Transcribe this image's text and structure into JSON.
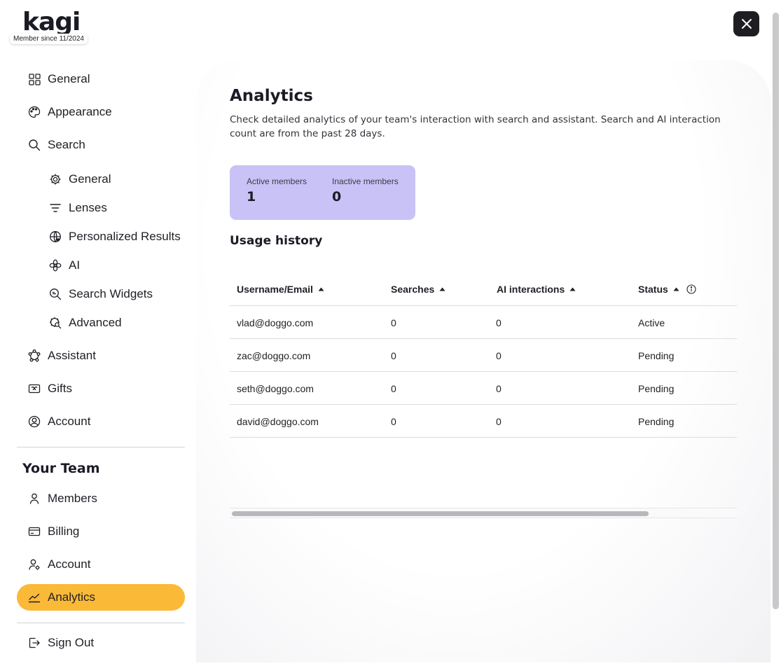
{
  "brand": {
    "logo_text": "kagi",
    "member_since": "Member since 11/2024"
  },
  "close_icon": "close-x-icon",
  "sidebar": {
    "items": [
      {
        "label": "General",
        "icon": "grid-icon"
      },
      {
        "label": "Appearance",
        "icon": "palette-icon"
      },
      {
        "label": "Search",
        "icon": "search-icon"
      },
      {
        "label": "General",
        "icon": "gear-icon"
      },
      {
        "label": "Lenses",
        "icon": "filter-icon"
      },
      {
        "label": "Personalized Results",
        "icon": "globe-heart-icon"
      },
      {
        "label": "AI",
        "icon": "ai-flower-icon"
      },
      {
        "label": "Search Widgets",
        "icon": "search-widget-icon"
      },
      {
        "label": "Advanced",
        "icon": "gear-search-icon"
      },
      {
        "label": "Assistant",
        "icon": "assistant-icon"
      },
      {
        "label": "Gifts",
        "icon": "gift-card-icon"
      },
      {
        "label": "Account",
        "icon": "account-circle-icon"
      }
    ],
    "team_heading": "Your Team",
    "team_items": [
      {
        "label": "Members",
        "icon": "person-icon"
      },
      {
        "label": "Billing",
        "icon": "credit-card-icon"
      },
      {
        "label": "Account",
        "icon": "person-gear-icon"
      },
      {
        "label": "Analytics",
        "icon": "chart-line-icon",
        "active": true
      }
    ],
    "sign_out": {
      "label": "Sign Out",
      "icon": "sign-out-icon"
    }
  },
  "main": {
    "title": "Analytics",
    "description": "Check detailed analytics of your team's interaction with search and assistant. Search and AI interaction count are from the past 28 days.",
    "stats": {
      "active_label": "Active members",
      "active_value": "1",
      "inactive_label": "Inactive members",
      "inactive_value": "0"
    },
    "usage_title": "Usage history",
    "table": {
      "headers": [
        "Username/Email",
        "Searches",
        "AI interactions",
        "Status"
      ],
      "rows": [
        [
          "vlad@doggo.com",
          "0",
          "0",
          "Active"
        ],
        [
          "zac@doggo.com",
          "0",
          "0",
          "Pending"
        ],
        [
          "seth@doggo.com",
          "0",
          "0",
          "Pending"
        ],
        [
          "david@doggo.com",
          "0",
          "0",
          "Pending"
        ]
      ]
    }
  },
  "colors": {
    "accent": "#fbb938",
    "stats_card": "#c9c2f7",
    "close_button": "#1d1d22"
  }
}
